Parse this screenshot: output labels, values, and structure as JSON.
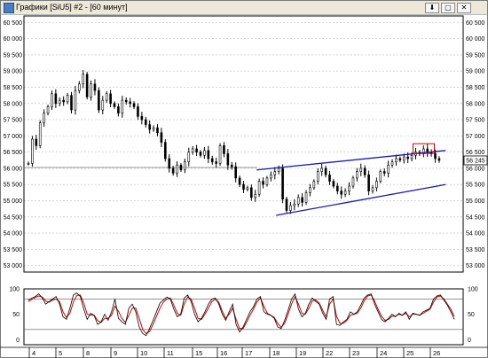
{
  "window": {
    "title": "Графики [SiU5] #2 - [60 минут]",
    "buttons": [
      "⬇",
      "▢",
      "✕"
    ]
  },
  "colors": {
    "candle": "#000000",
    "trend": "#1a1ab5",
    "highlight": "#cc0000",
    "stoch_k": "#000000",
    "stoch_d": "#cc0000",
    "grid": "#bfbfbf"
  },
  "price_axis": {
    "ticks": [
      "60 500",
      "60 000",
      "59 500",
      "59 000",
      "58 500",
      "58 000",
      "57 500",
      "57 000",
      "56 500",
      "56 000",
      "55 500",
      "55 000",
      "54 500",
      "54 000",
      "53 500",
      "53 000"
    ],
    "last_price": "56 245"
  },
  "oscillator": {
    "ticks": [
      "100",
      "50",
      "0"
    ]
  },
  "date_axis": {
    "labels": [
      "4",
      "5",
      "8",
      "9",
      "10",
      "11",
      "15",
      "16",
      "17",
      "18",
      "19",
      "22",
      "23",
      "24",
      "25",
      "26"
    ]
  },
  "chart_data": {
    "type": "candlestick",
    "ylim": [
      52800,
      60700
    ],
    "last_price": 56245,
    "close_series": [
      [
        0,
        56150
      ],
      [
        3,
        56900
      ],
      [
        6,
        56700
      ],
      [
        9,
        57400
      ],
      [
        12,
        57700
      ],
      [
        15,
        57900
      ],
      [
        18,
        58300
      ],
      [
        21,
        58000
      ],
      [
        24,
        58100
      ],
      [
        27,
        58050
      ],
      [
        30,
        58250
      ],
      [
        33,
        57800
      ],
      [
        36,
        58400
      ],
      [
        39,
        58600
      ],
      [
        42,
        58900
      ],
      [
        45,
        58200
      ],
      [
        48,
        58600
      ],
      [
        51,
        58400
      ],
      [
        54,
        57800
      ],
      [
        57,
        58100
      ],
      [
        60,
        58300
      ],
      [
        63,
        58000
      ],
      [
        66,
        57900
      ],
      [
        69,
        57700
      ],
      [
        72,
        58100
      ],
      [
        75,
        58050
      ],
      [
        78,
        58000
      ],
      [
        81,
        57900
      ],
      [
        84,
        57600
      ],
      [
        87,
        57500
      ],
      [
        90,
        57350
      ],
      [
        93,
        57200
      ],
      [
        96,
        57250
      ],
      [
        99,
        57100
      ],
      [
        102,
        56800
      ],
      [
        105,
        56300
      ],
      [
        108,
        56000
      ],
      [
        111,
        55850
      ],
      [
        114,
        56100
      ],
      [
        117,
        55950
      ],
      [
        120,
        56200
      ],
      [
        123,
        56500
      ],
      [
        126,
        56600
      ],
      [
        129,
        56500
      ],
      [
        132,
        56400
      ],
      [
        135,
        56550
      ],
      [
        138,
        56300
      ],
      [
        141,
        56200
      ],
      [
        144,
        56150
      ],
      [
        147,
        56700
      ],
      [
        150,
        56450
      ],
      [
        153,
        56100
      ],
      [
        156,
        56050
      ],
      [
        159,
        55700
      ],
      [
        162,
        55500
      ],
      [
        165,
        55350
      ],
      [
        168,
        55400
      ],
      [
        171,
        55100
      ],
      [
        174,
        55200
      ],
      [
        177,
        55600
      ],
      [
        180,
        55500
      ],
      [
        183,
        55700
      ],
      [
        186,
        55800
      ],
      [
        189,
        55900
      ],
      [
        192,
        56000
      ],
      [
        195,
        55050
      ],
      [
        198,
        54700
      ],
      [
        201,
        54850
      ],
      [
        204,
        54900
      ],
      [
        207,
        55100
      ],
      [
        210,
        54950
      ],
      [
        213,
        55250
      ],
      [
        216,
        55400
      ],
      [
        219,
        55600
      ],
      [
        222,
        55900
      ],
      [
        225,
        56000
      ],
      [
        228,
        55800
      ],
      [
        231,
        55600
      ],
      [
        234,
        55450
      ],
      [
        237,
        55300
      ],
      [
        240,
        55200
      ],
      [
        243,
        55300
      ],
      [
        246,
        55450
      ],
      [
        249,
        55700
      ],
      [
        252,
        55900
      ],
      [
        255,
        56000
      ],
      [
        258,
        55800
      ],
      [
        261,
        55300
      ],
      [
        264,
        55400
      ],
      [
        267,
        55600
      ],
      [
        270,
        55900
      ],
      [
        273,
        55850
      ],
      [
        276,
        56100
      ],
      [
        279,
        56200
      ],
      [
        282,
        56300
      ],
      [
        285,
        56250
      ],
      [
        288,
        56350
      ],
      [
        291,
        56300
      ],
      [
        294,
        56400
      ],
      [
        297,
        56500
      ],
      [
        300,
        56450
      ],
      [
        303,
        56600
      ],
      [
        306,
        56500
      ],
      [
        309,
        56450
      ],
      [
        312,
        56300
      ],
      [
        315,
        56245
      ]
    ],
    "trendlines": [
      {
        "from": [
          175,
          55950
        ],
        "to": [
          320,
          56550
        ]
      },
      {
        "from": [
          190,
          54550
        ],
        "to": [
          320,
          55500
        ]
      }
    ],
    "stochastic": {
      "ylim": [
        -10,
        100
      ],
      "levels": [
        80,
        20
      ],
      "k": [
        78,
        82,
        85,
        90,
        82,
        70,
        75,
        80,
        85,
        70,
        45,
        40,
        62,
        88,
        92,
        85,
        60,
        40,
        52,
        48,
        30,
        35,
        50,
        38,
        55,
        80,
        42,
        35,
        30,
        62,
        70,
        55,
        25,
        12,
        8,
        22,
        38,
        55,
        72,
        78,
        84,
        80,
        60,
        45,
        50,
        82,
        88,
        75,
        50,
        35,
        42,
        55,
        70,
        80,
        82,
        70,
        50,
        38,
        55,
        70,
        30,
        15,
        25,
        40,
        55,
        65,
        80,
        85,
        55,
        50,
        48,
        42,
        25,
        22,
        38,
        58,
        80,
        90,
        60,
        45,
        52,
        70,
        82,
        75,
        70,
        52,
        40,
        80,
        85,
        30,
        28,
        35,
        40,
        55,
        50,
        55,
        68,
        82,
        88,
        90,
        70,
        55,
        40,
        35,
        42,
        50,
        45,
        52,
        48,
        55,
        40,
        52,
        50,
        48,
        55,
        58,
        62,
        80,
        86,
        88,
        78,
        68,
        55,
        40
      ],
      "d": [
        75,
        79,
        83,
        86,
        84,
        76,
        74,
        78,
        80,
        75,
        55,
        44,
        52,
        74,
        87,
        88,
        72,
        50,
        48,
        48,
        38,
        34,
        42,
        42,
        48,
        66,
        56,
        42,
        34,
        48,
        62,
        62,
        42,
        20,
        12,
        16,
        30,
        46,
        62,
        74,
        80,
        82,
        68,
        52,
        48,
        70,
        84,
        80,
        62,
        42,
        40,
        50,
        62,
        75,
        80,
        74,
        56,
        42,
        50,
        62,
        40,
        22,
        22,
        34,
        48,
        60,
        74,
        82,
        66,
        52,
        48,
        44,
        32,
        24,
        32,
        50,
        70,
        85,
        70,
        52,
        50,
        62,
        76,
        78,
        72,
        58,
        45,
        70,
        80,
        46,
        32,
        32,
        38,
        48,
        50,
        52,
        62,
        76,
        86,
        88,
        76,
        60,
        46,
        38,
        40,
        46,
        46,
        50,
        48,
        52,
        45,
        50,
        50,
        48,
        52,
        56,
        60,
        74,
        84,
        86,
        80,
        70,
        60,
        46
      ]
    }
  }
}
